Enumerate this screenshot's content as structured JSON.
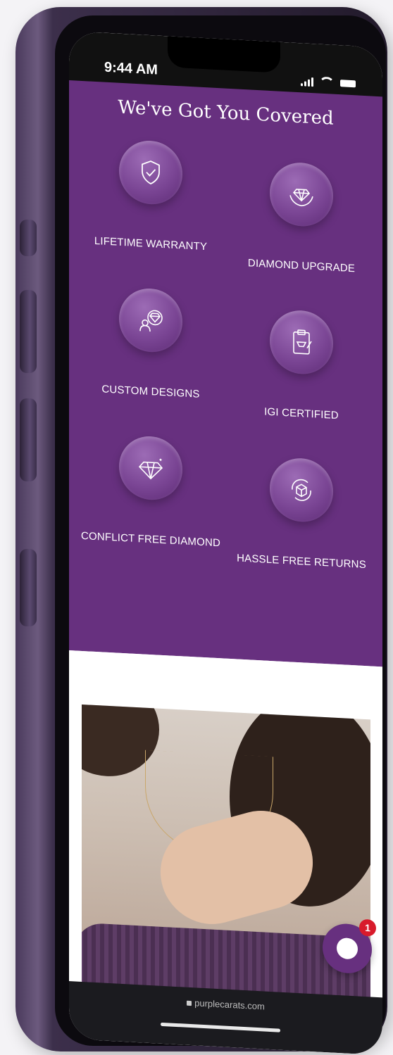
{
  "status_bar": {
    "time": "9:44 AM"
  },
  "section": {
    "heading": "We've Got You Covered",
    "features": [
      {
        "label": "LIFETIME WARRANTY",
        "icon": "shield-check-icon"
      },
      {
        "label": "DIAMOND UPGRADE",
        "icon": "diamond-hands-icon"
      },
      {
        "label": "CUSTOM DESIGNS",
        "icon": "custom-design-icon"
      },
      {
        "label": "IGI CERTIFIED",
        "icon": "certificate-icon"
      },
      {
        "label": "CONFLICT FREE DIAMOND",
        "icon": "diamond-icon"
      },
      {
        "label": "HASSLE FREE RETURNS",
        "icon": "returns-box-icon"
      }
    ]
  },
  "chat": {
    "badge_count": "1"
  },
  "browser": {
    "url": "purplecarats.com"
  },
  "colors": {
    "brand_purple": "#67307f",
    "badge_red": "#d81b2b"
  }
}
